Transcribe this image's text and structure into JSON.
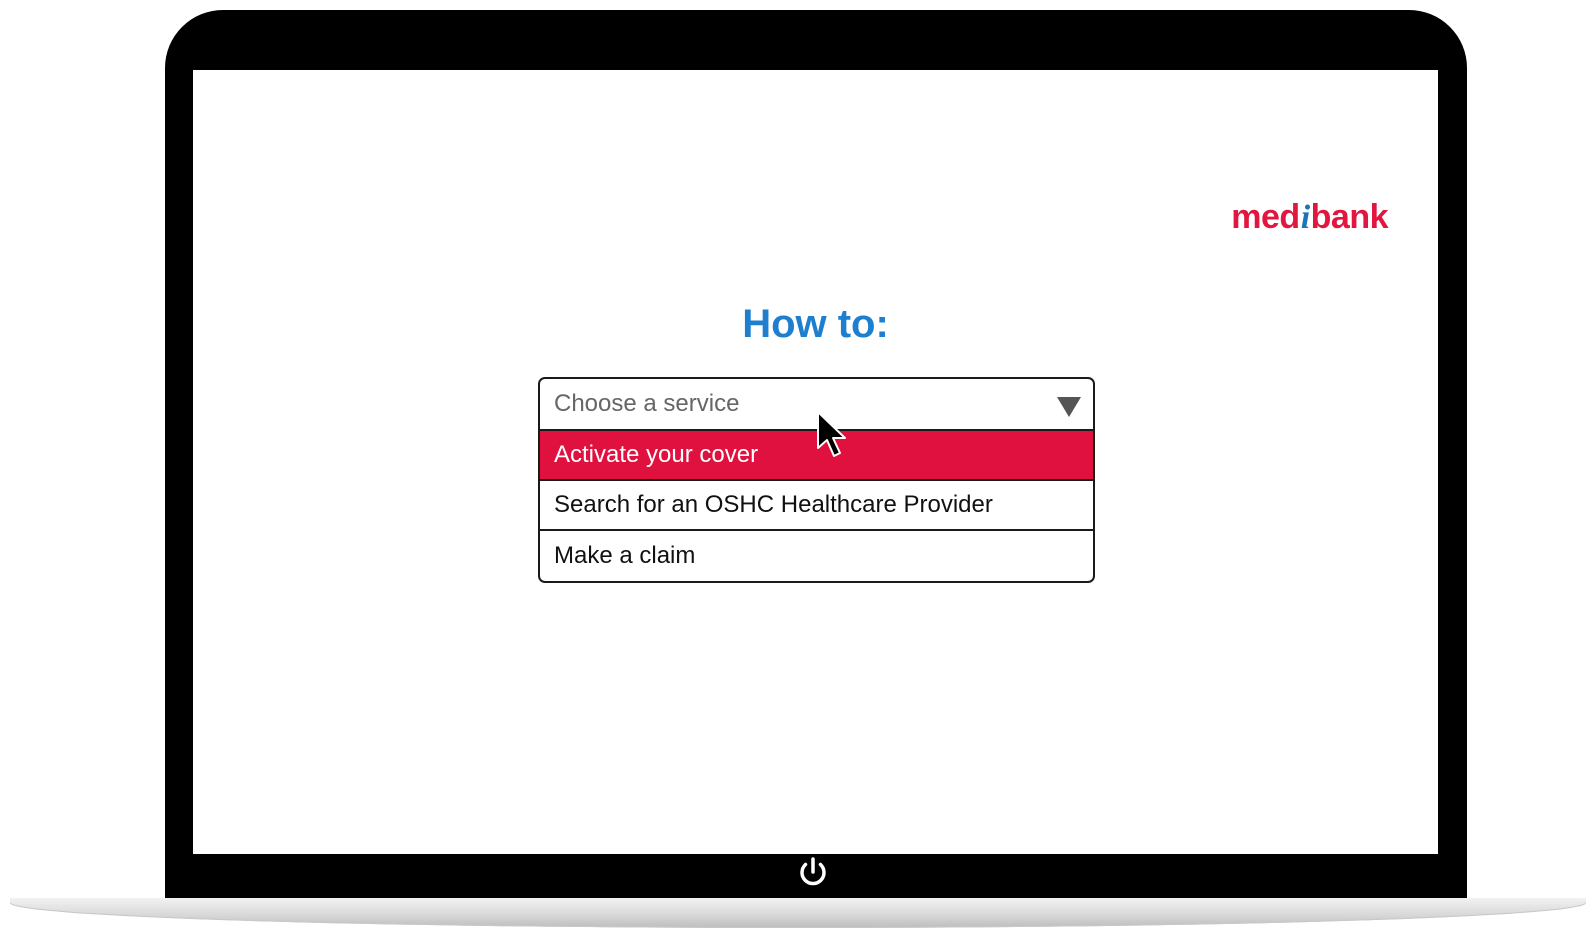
{
  "brand": {
    "logo_prefix": "med",
    "logo_accent": "i",
    "logo_suffix": "bank",
    "color": "#e1173f",
    "accent_color": "#1e73be"
  },
  "main": {
    "title": "How to:",
    "title_color": "#1e7fce"
  },
  "service_select": {
    "placeholder": "Choose a service",
    "icon": "triangle-down-icon",
    "options": [
      {
        "label": "Activate your cover",
        "highlighted": true
      },
      {
        "label": "Search for an OSHC Healthcare Provider",
        "highlighted": false
      },
      {
        "label": "Make a claim",
        "highlighted": false
      }
    ],
    "highlight_color": "#e0113f"
  },
  "device": {
    "power_icon": "power-icon",
    "cursor_icon": "mouse-pointer-icon"
  }
}
